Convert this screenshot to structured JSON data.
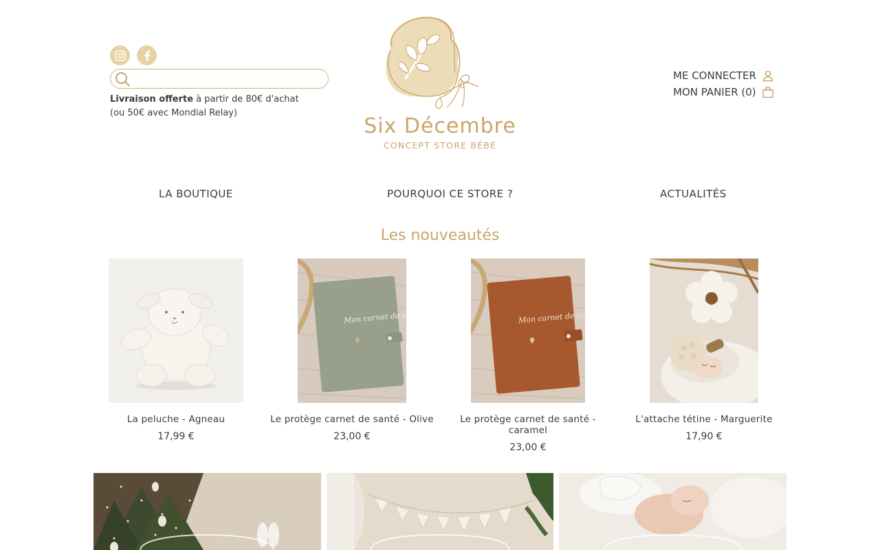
{
  "brand": {
    "name": "Six Décembre",
    "tagline": "CONCEPT STORE BÉBÉ",
    "accent_color": "#c9a56a",
    "logo_fill": "#ecdcb8"
  },
  "header": {
    "social": [
      "instagram-icon",
      "facebook-icon"
    ],
    "search": {
      "placeholder": "",
      "value": ""
    },
    "shipping": {
      "bold": "Livraison offerte",
      "rest": " à partir de 80€ d'achat",
      "line2": "(ou 50€ avec Mondial Relay)"
    },
    "account": {
      "login_label": "ME CONNECTER",
      "cart_label": "MON PANIER (0)"
    }
  },
  "nav": {
    "items": [
      "LA BOUTIQUE",
      "POURQUOI CE STORE ?",
      "ACTUALITÉS"
    ]
  },
  "section": {
    "title": "Les nouveautés"
  },
  "products": [
    {
      "name": "La peluche - Agneau",
      "price": "17,99 €"
    },
    {
      "name": "Le protège carnet de santé - Olive",
      "price": "23,00 €",
      "embroidery": "Mon carnet de santé"
    },
    {
      "name": "Le protège carnet de santé - caramel",
      "price": "23,00 €",
      "embroidery": "Mon carnet de santé"
    },
    {
      "name": "L'attache tétine - Marguerite",
      "price": "17,90 €"
    }
  ]
}
